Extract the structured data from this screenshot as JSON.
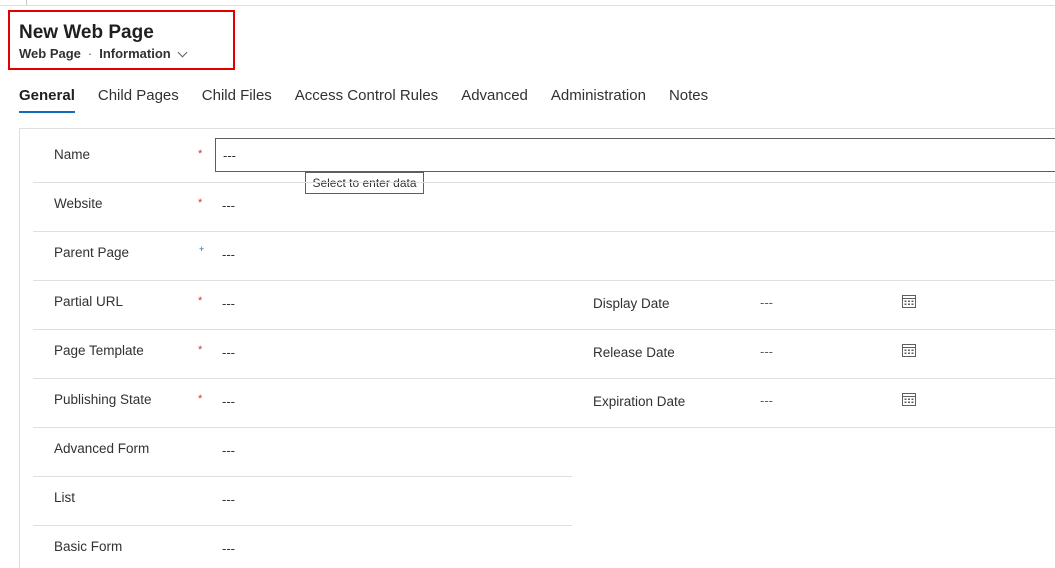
{
  "header": {
    "title": "New Web Page",
    "entity": "Web Page",
    "separator": "·",
    "form_name": "Information"
  },
  "tabs": [
    {
      "label": "General",
      "active": true
    },
    {
      "label": "Child Pages"
    },
    {
      "label": "Child Files"
    },
    {
      "label": "Access Control Rules"
    },
    {
      "label": "Advanced"
    },
    {
      "label": "Administration"
    },
    {
      "label": "Notes"
    }
  ],
  "fields": {
    "name": {
      "label": "Name",
      "required": "*",
      "value": "---"
    },
    "website": {
      "label": "Website",
      "required": "*",
      "value": "---"
    },
    "parent_page": {
      "label": "Parent Page",
      "recommended": "+",
      "value": "---"
    },
    "partial_url": {
      "label": "Partial URL",
      "required": "*",
      "value": "---"
    },
    "page_template": {
      "label": "Page Template",
      "required": "*",
      "value": "---"
    },
    "publishing_state": {
      "label": "Publishing State",
      "required": "*",
      "value": "---"
    },
    "advanced_form": {
      "label": "Advanced Form",
      "value": "---"
    },
    "list": {
      "label": "List",
      "value": "---"
    },
    "basic_form": {
      "label": "Basic Form",
      "value": "---"
    }
  },
  "dates": {
    "display_date": {
      "label": "Display Date",
      "value": "---"
    },
    "release_date": {
      "label": "Release Date",
      "value": "---"
    },
    "expiration_date": {
      "label": "Expiration Date",
      "value": "---"
    }
  },
  "tooltip": "Select to enter data",
  "colors": {
    "required": "#d13438",
    "recommended": "#0f6cbd",
    "active_tab_underline": "#0f6cbd",
    "highlight_box": "#e00000"
  }
}
